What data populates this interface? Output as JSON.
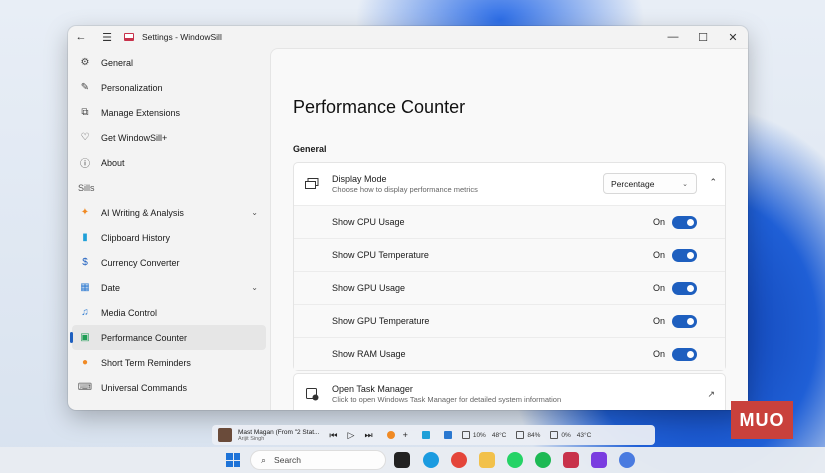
{
  "window": {
    "title": "Settings - WindowSill",
    "back_glyph": "←",
    "menu_glyph": "☰",
    "minimize_glyph": "—",
    "maximize_glyph": "☐",
    "close_glyph": "✕"
  },
  "sidebar": {
    "items": [
      {
        "label": "General",
        "icon": "gear-icon",
        "glyph": "⚙"
      },
      {
        "label": "Personalization",
        "icon": "pen-icon",
        "glyph": "✎"
      },
      {
        "label": "Manage Extensions",
        "icon": "puzzle-icon",
        "glyph": "⧉"
      },
      {
        "label": "Get WindowSill+",
        "icon": "heart-icon",
        "glyph": "♡"
      },
      {
        "label": "About",
        "icon": "info-icon",
        "glyph": "ⓘ"
      }
    ],
    "section_label": "Sills",
    "sills": [
      {
        "label": "AI Writing & Analysis",
        "icon": "sparkle-icon",
        "glyph": "✦",
        "color": "#f08a24",
        "expandable": true
      },
      {
        "label": "Clipboard History",
        "icon": "clipboard-icon",
        "glyph": "▮",
        "color": "#1fa0d8",
        "expandable": false
      },
      {
        "label": "Currency Converter",
        "icon": "currency-icon",
        "glyph": "$",
        "color": "#1e5fbf",
        "expandable": false
      },
      {
        "label": "Date",
        "icon": "calendar-icon",
        "glyph": "▦",
        "color": "#2a78d0",
        "expandable": true
      },
      {
        "label": "Media Control",
        "icon": "media-icon",
        "glyph": "♫",
        "color": "#2a78d0",
        "expandable": false
      },
      {
        "label": "Performance Counter",
        "icon": "chart-icon",
        "glyph": "▣",
        "color": "#1f9d55",
        "expandable": false,
        "active": true
      },
      {
        "label": "Short Term Reminders",
        "icon": "reminder-icon",
        "glyph": "●",
        "color": "#f08a24",
        "expandable": false
      },
      {
        "label": "Universal Commands",
        "icon": "keyboard-icon",
        "glyph": "⌨",
        "color": "#666666",
        "expandable": false
      }
    ],
    "chevron_glyph": "⌄"
  },
  "main": {
    "title": "Performance Counter",
    "group_title": "General",
    "display_mode": {
      "title": "Display Mode",
      "subtitle": "Choose how to display performance metrics",
      "selected": "Percentage",
      "collapse_glyph": "⌃"
    },
    "toggles": [
      {
        "label": "Show CPU Usage",
        "state": "On",
        "checked": true
      },
      {
        "label": "Show CPU Temperature",
        "state": "On",
        "checked": true
      },
      {
        "label": "Show GPU Usage",
        "state": "On",
        "checked": true
      },
      {
        "label": "Show GPU Temperature",
        "state": "On",
        "checked": true
      },
      {
        "label": "Show RAM Usage",
        "state": "On",
        "checked": true
      }
    ],
    "task_manager": {
      "title": "Open Task Manager",
      "subtitle": "Click to open Windows Task Manager for detailed system information",
      "launch_glyph": "↗"
    }
  },
  "sill_bar": {
    "track": "Mast Magan (From \"2 Stat...",
    "artist": "Arijit Singh",
    "prev_glyph": "⏮",
    "play_glyph": "▷",
    "next_glyph": "⏭",
    "add_glyph": "+",
    "cpu": "10%",
    "cpu_temp": "48°C",
    "ram": "84%",
    "gpu": "0%",
    "gpu_temp": "43°C"
  },
  "taskbar": {
    "search_placeholder": "Search",
    "search_glyph": "⌕"
  },
  "watermark": "MUO",
  "colors": {
    "accent": "#1e5fbf",
    "window_bg": "#f3f3f3",
    "content_bg": "#f9f9f9"
  }
}
